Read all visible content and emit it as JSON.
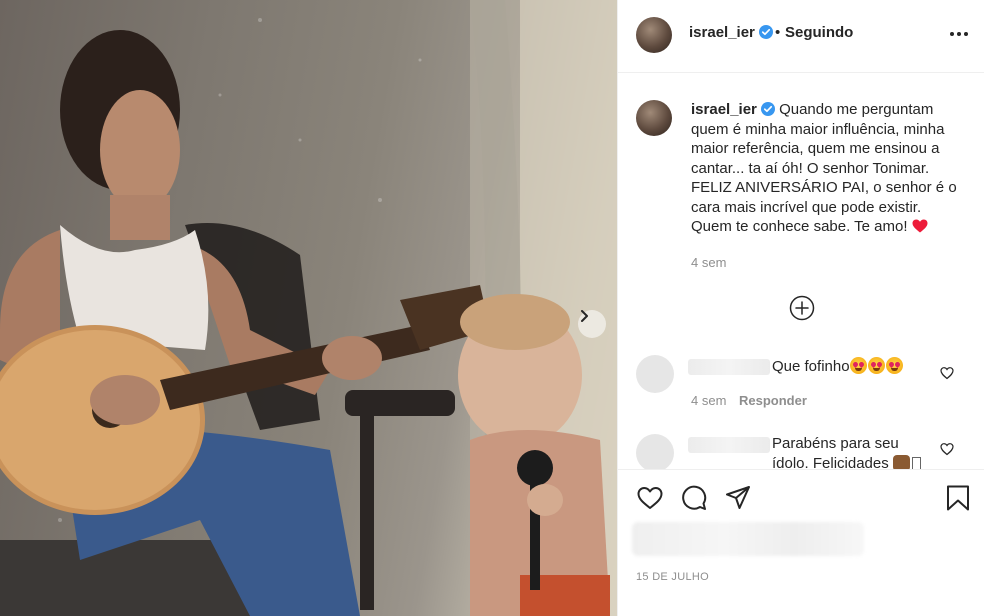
{
  "post": {
    "username": "israel_ier",
    "verified": true,
    "separator": "•",
    "follow_status": "Seguindo"
  },
  "caption": {
    "username": "israel_ier",
    "text": "Quando me perguntam quem é minha maior influência, minha maior referência, quem me ensinou a cantar... ta aí óh! O senhor Tonimar. FELIZ ANIVERSÁRIO PAI, o senhor é o cara mais incrível que pode existir. Quem te conhece sabe. Te amo!",
    "emoji": "red-heart",
    "time": "4 sem"
  },
  "comments": [
    {
      "text": "Que fofinho",
      "emojis": [
        "heart-eyes",
        "heart-eyes",
        "heart-eyes"
      ],
      "time": "4 sem",
      "reply_label": "Responder"
    },
    {
      "text": "Parabéns para seu ídolo. Felicidades",
      "emojis": [
        "sign-emoji"
      ]
    }
  ],
  "footer": {
    "date": "15 DE JULHO"
  },
  "icons": [
    "more-options-icon",
    "verified-badge-icon",
    "load-more-icon",
    "like-icon",
    "comment-icon",
    "share-icon",
    "save-icon",
    "carousel-next-icon"
  ],
  "colors": {
    "verified": "#3897f0",
    "heart": "#ed4956",
    "muted": "#8e8e8e",
    "text": "#262626"
  }
}
